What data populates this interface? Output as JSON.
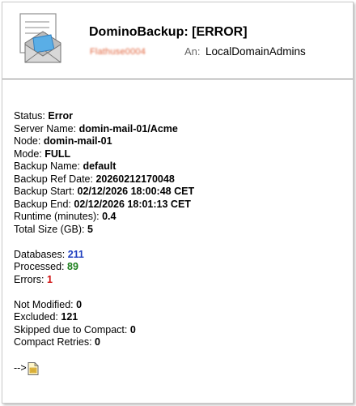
{
  "message": {
    "subject": "DominoBackup: [ERROR]",
    "sender": "Flathuse0004",
    "to_label": "An:",
    "to_value": "LocalDomainAdmins"
  },
  "icons": {
    "mail": "envelope-document-icon",
    "attachment": "document-link-icon"
  },
  "details": {
    "status": {
      "label": "Status:",
      "value": "Error"
    },
    "server_name": {
      "label": "Server Name:",
      "value": "domin-mail-01/Acme"
    },
    "node": {
      "label": "Node:",
      "value": "domin-mail-01"
    },
    "mode": {
      "label": "Mode:",
      "value": "FULL"
    },
    "backup_name": {
      "label": "Backup Name:",
      "value": "default"
    },
    "backup_ref_date": {
      "label": "Backup Ref Date:",
      "value": "20260212170048"
    },
    "backup_start": {
      "label": "Backup Start:",
      "value": "02/12/2026 18:00:48 CET"
    },
    "backup_end": {
      "label": "Backup End:",
      "value": "02/12/2026 18:01:13 CET"
    },
    "runtime": {
      "label": "Runtime (minutes):",
      "value": "0.4"
    },
    "total_size": {
      "label": "Total Size (GB):",
      "value": "5"
    }
  },
  "counts": {
    "databases": {
      "label": "Databases:",
      "value": "211"
    },
    "processed": {
      "label": "Processed:",
      "value": "89"
    },
    "errors": {
      "label": "Errors:",
      "value": "1"
    }
  },
  "extra": {
    "not_modified": {
      "label": "Not Modified:",
      "value": "0"
    },
    "excluded": {
      "label": "Excluded:",
      "value": "121"
    },
    "skipped_compact": {
      "label": "Skipped due to Compact:",
      "value": "0"
    },
    "compact_retries": {
      "label": "Compact Retries:",
      "value": "0"
    }
  },
  "link": {
    "arrow": "-->"
  },
  "colors": {
    "databases": "#1f3fbf",
    "processed": "#1b7f1b",
    "errors": "#d01010"
  }
}
